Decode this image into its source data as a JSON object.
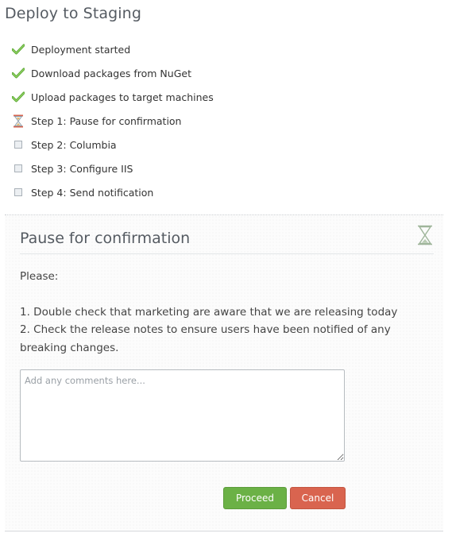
{
  "page": {
    "title": "Deploy to Staging"
  },
  "steps": [
    {
      "label": "Deployment started",
      "status": "complete",
      "icon": "check-icon"
    },
    {
      "label": "Download packages from NuGet",
      "status": "complete",
      "icon": "check-icon"
    },
    {
      "label": "Upload packages to target machines",
      "status": "complete",
      "icon": "check-icon"
    },
    {
      "label": "Step 1: Pause for confirmation",
      "status": "waiting",
      "icon": "hourglass-icon"
    },
    {
      "label": "Step 2: Columbia",
      "status": "pending",
      "icon": "pending-square-icon"
    },
    {
      "label": "Step 3: Configure IIS",
      "status": "pending",
      "icon": "pending-square-icon"
    },
    {
      "label": "Step 4: Send notification",
      "status": "pending",
      "icon": "pending-square-icon"
    }
  ],
  "panel": {
    "title": "Pause for confirmation",
    "icon": "hourglass-icon",
    "instructions": {
      "intro": "Please:",
      "line1": "1. Double check that marketing are aware that we are releasing today",
      "line2": "2. Check the release notes to ensure users have been notified of any breaking changes."
    },
    "comments": {
      "placeholder": "Add any comments here...",
      "value": ""
    },
    "proceed_label": "Proceed",
    "cancel_label": "Cancel"
  },
  "colors": {
    "check": "#5aa832",
    "proceed": "#6bb146",
    "cancel": "#d9644f",
    "title": "#555b62"
  }
}
